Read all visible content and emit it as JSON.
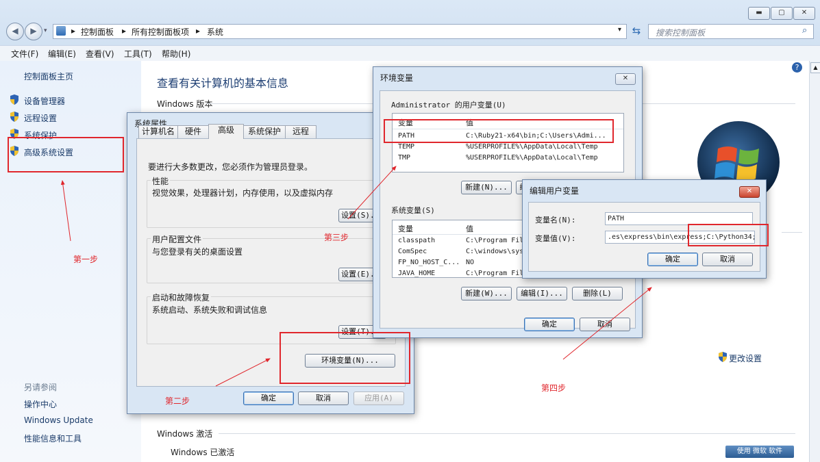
{
  "window": {
    "minimize": "▬",
    "maximize": "▢",
    "close": "✕"
  },
  "breadcrumb": [
    "控制面板",
    "所有控制面板项",
    "系统"
  ],
  "search": {
    "placeholder": "搜索控制面板"
  },
  "menu": [
    "文件(F)",
    "编辑(E)",
    "查看(V)",
    "工具(T)",
    "帮助(H)"
  ],
  "sidebar": {
    "home": "控制面板主页",
    "items": [
      "设备管理器",
      "远程设置",
      "系统保护",
      "高级系统设置"
    ],
    "see_also_title": "另请参阅",
    "see_also": [
      "操作中心",
      "Windows Update",
      "性能信息和工具"
    ]
  },
  "main": {
    "title": "查看有关计算机的基本信息",
    "windows_version": "Windows 版本",
    "change_settings": "更改设置",
    "activation": "Windows 激活",
    "activated": "Windows 已激活",
    "badge": "使用 微软 软件"
  },
  "sysprops": {
    "title": "系统属性",
    "tabs": [
      "计算机名",
      "硬件",
      "高级",
      "系统保护",
      "远程"
    ],
    "admin_note": "要进行大多数更改，您必须作为管理员登录。",
    "perf_label": "性能",
    "perf_desc": "视觉效果，处理器计划，内存使用，以及虚拟内存",
    "profile_label": "用户配置文件",
    "profile_desc": "与您登录有关的桌面设置",
    "startup_label": "启动和故障恢复",
    "startup_desc": "系统启动、系统失败和调试信息",
    "settings_btn_1": "设置(S)...",
    "settings_btn_2": "设置(E)...",
    "settings_btn_3": "设置(T)...",
    "env_btn": "环境变量(N)...",
    "ok": "确定",
    "cancel": "取消",
    "apply": "应用(A)"
  },
  "envvars": {
    "title": "环境变量",
    "user_section": "Administrator 的用户变量(U)",
    "col_var": "变量",
    "col_val": "值",
    "user_vars": [
      {
        "name": "PATH",
        "value": "C:\\Ruby21-x64\\bin;C:\\Users\\Admi..."
      },
      {
        "name": "TEMP",
        "value": "%USERPROFILE%\\AppData\\Local\\Temp"
      },
      {
        "name": "TMP",
        "value": "%USERPROFILE%\\AppData\\Local\\Temp"
      }
    ],
    "user_new": "新建(N)...",
    "user_edit": "编",
    "sys_section": "系统变量(S)",
    "sys_vars": [
      {
        "name": "classpath",
        "value": "C:\\Program Fil"
      },
      {
        "name": "ComSpec",
        "value": "C:\\windows\\sys"
      },
      {
        "name": "FP_NO_HOST_C...",
        "value": "NO"
      },
      {
        "name": "JAVA_HOME",
        "value": "C:\\Program Fil"
      }
    ],
    "sys_new": "新建(W)...",
    "sys_edit": "编辑(I)...",
    "sys_delete": "删除(L)",
    "ok": "确定",
    "cancel": "取消"
  },
  "editvar": {
    "title": "编辑用户变量",
    "name_label": "变量名(N):",
    "name_value": "PATH",
    "value_label": "变量值(V):",
    "value_value": ".es\\express\\bin\\express;C:\\Python34;",
    "ok": "确定",
    "cancel": "取消"
  },
  "annotations": {
    "step1": "第一步",
    "step2": "第二步",
    "step3": "第三步",
    "step4": "第四步",
    "color": "#e0262c"
  }
}
